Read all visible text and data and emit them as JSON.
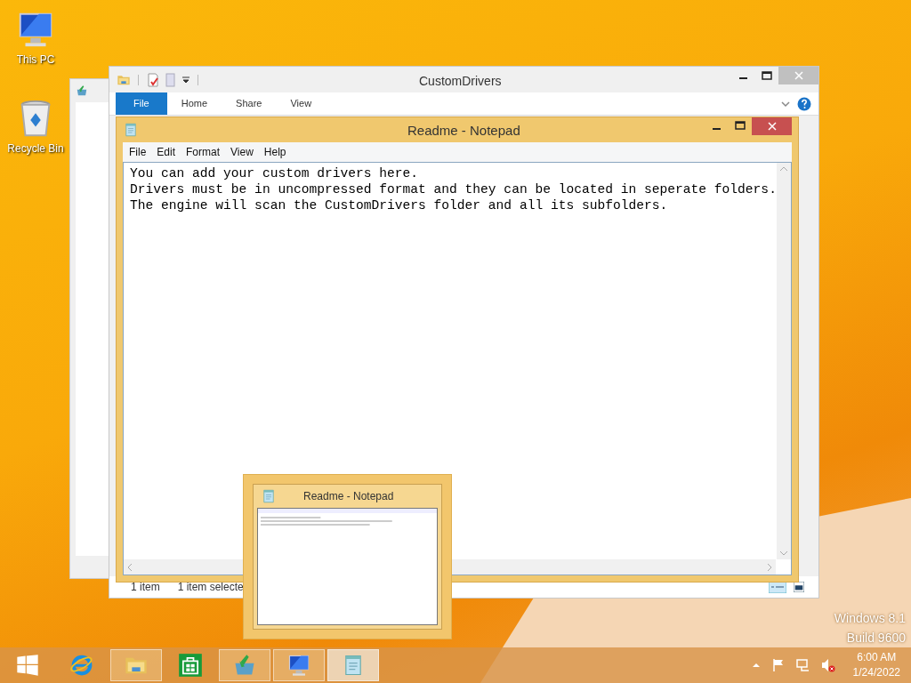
{
  "desktop_icons": [
    {
      "kind": "computer",
      "label": "This PC"
    },
    {
      "kind": "bin",
      "label": "Recycle Bin"
    }
  ],
  "explorer": {
    "title": "CustomDrivers",
    "ribbon_tabs": [
      {
        "label": "File",
        "selected": true
      },
      {
        "label": "Home",
        "selected": false
      },
      {
        "label": "Share",
        "selected": false
      },
      {
        "label": "View",
        "selected": false
      }
    ],
    "status_bar": [
      "1 item",
      "1 item selecte"
    ]
  },
  "notepad": {
    "title": "Readme - Notepad",
    "menu": [
      "File",
      "Edit",
      "Format",
      "View",
      "Help"
    ],
    "lines": [
      "You can add your custom drivers here.",
      "Drivers must be in uncompressed format and they can be located in seperate folders.",
      "The engine will scan the CustomDrivers folder and all its subfolders."
    ]
  },
  "thumbnail": {
    "title": "Readme - Notepad"
  },
  "taskbar": {
    "items": [
      {
        "kind": "start",
        "running": false,
        "selected": false
      },
      {
        "kind": "browser",
        "running": false,
        "selected": false
      },
      {
        "kind": "folder",
        "running": true,
        "selected": false
      },
      {
        "kind": "store",
        "running": false,
        "selected": false
      },
      {
        "kind": "installer",
        "running": true,
        "selected": false
      },
      {
        "kind": "computer",
        "running": true,
        "selected": false
      },
      {
        "kind": "notepad",
        "running": true,
        "selected": true
      }
    ],
    "clock": {
      "time": "6:00 AM",
      "date": "1/24/2022"
    }
  },
  "watermark": [
    "Windows 8.1",
    "Build 9600"
  ]
}
